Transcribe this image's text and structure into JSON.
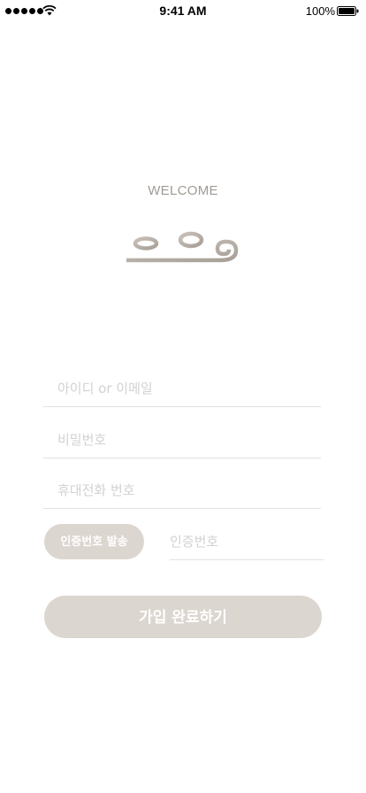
{
  "status_bar": {
    "time": "9:41 AM",
    "battery": "100%",
    "icons": [
      "signal-dots-icon",
      "wifi-icon",
      "battery-icon"
    ]
  },
  "header": {
    "welcome": "WELCOME",
    "logo_icon": "huwoo-logo-icon"
  },
  "form": {
    "id_placeholder": "아이디 or 이메일",
    "password_placeholder": "비밀번호",
    "phone_placeholder": "휴대전화 번호",
    "send_code_label": "인증번호 발송",
    "code_placeholder": "인증번호",
    "submit_label": "가입 완료하기"
  },
  "colors": {
    "accent": "#dcd6d0",
    "welcome_text": "#a09a94",
    "placeholder": "#d2d2d2",
    "divider": "#e2e2e2"
  }
}
